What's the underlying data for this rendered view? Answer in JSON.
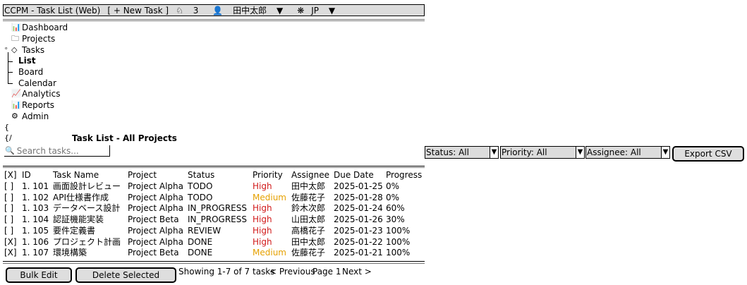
{
  "window": {
    "title": "CCPM - Task List (Web)",
    "new_task": "[ + New Task ]",
    "notifications": "3",
    "user": "田中太郎",
    "language": "JP"
  },
  "sidebar": {
    "items": [
      {
        "label": "Dashboard",
        "icon": "bar-chart-icon"
      },
      {
        "label": "Projects",
        "icon": "folder-icon"
      },
      {
        "label": "Tasks",
        "icon": "tag-icon"
      },
      {
        "label": "List",
        "icon": "",
        "active": true
      },
      {
        "label": "Board",
        "icon": ""
      },
      {
        "label": "Calendar",
        "icon": ""
      },
      {
        "label": "Analytics",
        "icon": "line-chart-icon"
      },
      {
        "label": "Reports",
        "icon": "bar-chart-icon"
      },
      {
        "label": "Admin",
        "icon": "gear-icon"
      }
    ]
  },
  "main": {
    "brace_open": "{",
    "brace_close": "{/",
    "title": "Task List - All Projects",
    "search_placeholder": "Search tasks..."
  },
  "filters": {
    "status": "Status: All",
    "priority": "Priority: All",
    "assignee": "Assignee: All",
    "export": "Export CSV"
  },
  "table": {
    "headers": {
      "select": "[X]",
      "id": "ID",
      "name": "Task Name",
      "project": "Project",
      "status": "Status",
      "priority": "Priority",
      "assignee": "Assignee",
      "due": "Due Date",
      "progress": "Progress"
    },
    "rows": [
      {
        "check": "[ ]",
        "id": "1. 101",
        "name": "画面設計レビュー",
        "project": "Project Alpha",
        "status": "TODO",
        "priority": "High",
        "assignee": "田中太郎",
        "due": "2025-01-25",
        "progress": "0%"
      },
      {
        "check": "[ ]",
        "id": "1. 102",
        "name": "API仕様書作成",
        "project": "Project Alpha",
        "status": "TODO",
        "priority": "Medium",
        "assignee": "佐藤花子",
        "due": "2025-01-28",
        "progress": "0%"
      },
      {
        "check": "[ ]",
        "id": "1. 103",
        "name": "データベース設計",
        "project": "Project Alpha",
        "status": "IN_PROGRESS",
        "priority": "High",
        "assignee": "鈴木次郎",
        "due": "2025-01-24",
        "progress": "60%"
      },
      {
        "check": "[ ]",
        "id": "1. 104",
        "name": "認証機能実装",
        "project": "Project Beta",
        "status": "IN_PROGRESS",
        "priority": "High",
        "assignee": "山田太郎",
        "due": "2025-01-26",
        "progress": "30%"
      },
      {
        "check": "[ ]",
        "id": "1. 105",
        "name": "要件定義書",
        "project": "Project Alpha",
        "status": "REVIEW",
        "priority": "High",
        "assignee": "高橋花子",
        "due": "2025-01-23",
        "progress": "100%"
      },
      {
        "check": "[X]",
        "id": "1. 106",
        "name": "プロジェクト計画",
        "project": "Project Alpha",
        "status": "DONE",
        "priority": "High",
        "assignee": "田中太郎",
        "due": "2025-01-22",
        "progress": "100%"
      },
      {
        "check": "[X]",
        "id": "1. 107",
        "name": "環境構築",
        "project": "Project Beta",
        "status": "DONE",
        "priority": "Medium",
        "assignee": "佐藤花子",
        "due": "2025-01-21",
        "progress": "100%"
      }
    ]
  },
  "footer": {
    "bulk_edit": "Bulk Edit",
    "delete_selected": "Delete Selected",
    "showing": "Showing 1-7 of 7 tasks",
    "previous": "< Previous",
    "page": "Page 1",
    "next": "Next >"
  },
  "colors": {
    "high": "#d11a1a",
    "medium": "#e6a100",
    "chrome": "#dcdcdc"
  }
}
